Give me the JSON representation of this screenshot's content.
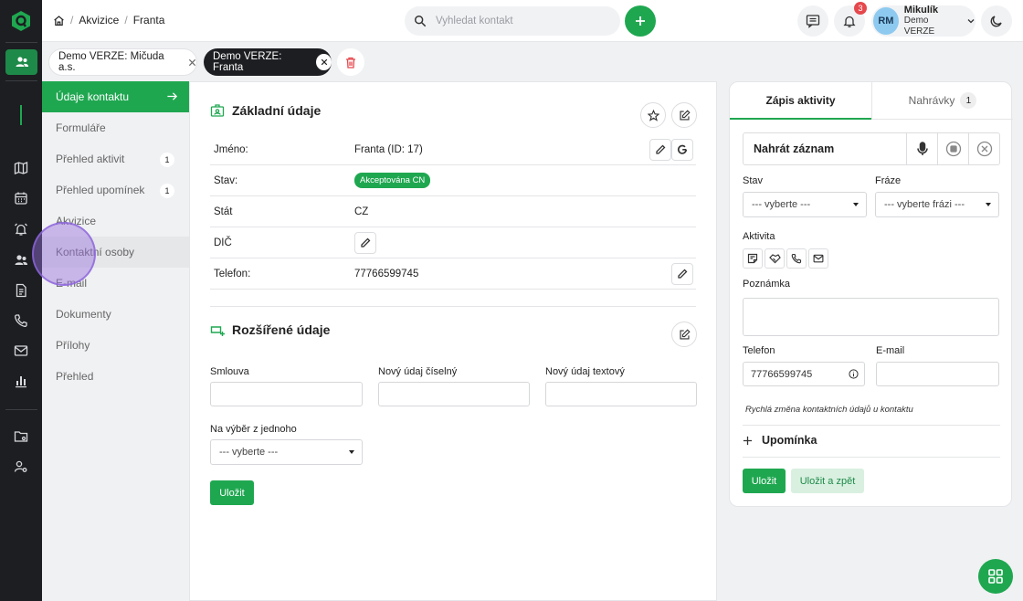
{
  "breadcrumb": {
    "items": [
      "Akvizice",
      "Franta"
    ]
  },
  "search": {
    "placeholder": "Vyhledat kontakt"
  },
  "notifications": {
    "count": "3"
  },
  "user": {
    "initials": "RM",
    "name": "Mikulík",
    "org": "Demo VERZE"
  },
  "tabs": [
    {
      "label": "Demo VERZE: Mičuda a.s."
    },
    {
      "label": "Demo VERZE: Franta"
    }
  ],
  "subnav": {
    "items": [
      {
        "label": "Údaje kontaktu"
      },
      {
        "label": "Formuláře"
      },
      {
        "label": "Přehled aktivit",
        "count": "1"
      },
      {
        "label": "Přehled upomínek",
        "count": "1"
      },
      {
        "label": "Akvizice"
      },
      {
        "label": "Kontaktní osoby"
      },
      {
        "label": "E-mail"
      },
      {
        "label": "Dokumenty"
      },
      {
        "label": "Přílohy"
      },
      {
        "label": "Přehled"
      }
    ]
  },
  "basic": {
    "title": "Základní údaje",
    "rows": [
      {
        "label": "Jméno:",
        "value": "Franta (ID: 17)"
      },
      {
        "label": "Stav:",
        "value": "Akceptována CN"
      },
      {
        "label": "Stát",
        "value": "CZ"
      },
      {
        "label": "DIČ",
        "value": ""
      },
      {
        "label": "Telefon:",
        "value": "77766599745"
      }
    ]
  },
  "extended": {
    "title": "Rozšířené údaje",
    "fields": [
      {
        "label": "Smlouva",
        "value": ""
      },
      {
        "label": "Nový údaj číselný",
        "value": ""
      },
      {
        "label": "Nový údaj textový",
        "value": ""
      }
    ],
    "select_label": "Na výběr z jednoho",
    "select_value": "--- vyberte ---",
    "save_label": "Uložit"
  },
  "activity": {
    "tab_active": "Zápis aktivity",
    "tab_other": "Nahrávky",
    "tab_other_count": "1",
    "record_label": "Nahrát záznam",
    "state_label": "Stav",
    "state_value": "--- vyberte ---",
    "phrase_label": "Fráze",
    "phrase_value": "--- vyberte frázi ---",
    "activity_label": "Aktivita",
    "note_label": "Poznámka",
    "note_value": "",
    "phone_label": "Telefon",
    "phone_value": "77766599745",
    "email_label": "E-mail",
    "email_value": "",
    "hint": "Rychlá změna kontaktních údajů u kontaktu",
    "reminder_label": "Upomínka",
    "save_label": "Uložit",
    "save_back_label": "Uložit a zpět"
  },
  "colors": {
    "accent": "#1fa750",
    "sidebar": "#1c1e21",
    "danger": "#e5484d"
  }
}
